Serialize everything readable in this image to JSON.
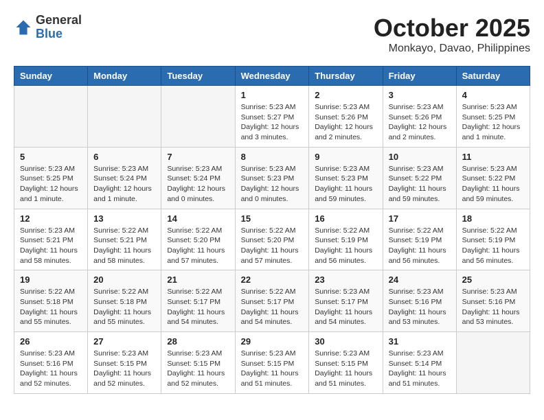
{
  "header": {
    "logo_general": "General",
    "logo_blue": "Blue",
    "title": "October 2025",
    "location": "Monkayo, Davao, Philippines"
  },
  "weekdays": [
    "Sunday",
    "Monday",
    "Tuesday",
    "Wednesday",
    "Thursday",
    "Friday",
    "Saturday"
  ],
  "weeks": [
    [
      {
        "day": "",
        "info": ""
      },
      {
        "day": "",
        "info": ""
      },
      {
        "day": "",
        "info": ""
      },
      {
        "day": "1",
        "info": "Sunrise: 5:23 AM\nSunset: 5:27 PM\nDaylight: 12 hours\nand 3 minutes."
      },
      {
        "day": "2",
        "info": "Sunrise: 5:23 AM\nSunset: 5:26 PM\nDaylight: 12 hours\nand 2 minutes."
      },
      {
        "day": "3",
        "info": "Sunrise: 5:23 AM\nSunset: 5:26 PM\nDaylight: 12 hours\nand 2 minutes."
      },
      {
        "day": "4",
        "info": "Sunrise: 5:23 AM\nSunset: 5:25 PM\nDaylight: 12 hours\nand 1 minute."
      }
    ],
    [
      {
        "day": "5",
        "info": "Sunrise: 5:23 AM\nSunset: 5:25 PM\nDaylight: 12 hours\nand 1 minute."
      },
      {
        "day": "6",
        "info": "Sunrise: 5:23 AM\nSunset: 5:24 PM\nDaylight: 12 hours\nand 1 minute."
      },
      {
        "day": "7",
        "info": "Sunrise: 5:23 AM\nSunset: 5:24 PM\nDaylight: 12 hours\nand 0 minutes."
      },
      {
        "day": "8",
        "info": "Sunrise: 5:23 AM\nSunset: 5:23 PM\nDaylight: 12 hours\nand 0 minutes."
      },
      {
        "day": "9",
        "info": "Sunrise: 5:23 AM\nSunset: 5:23 PM\nDaylight: 11 hours\nand 59 minutes."
      },
      {
        "day": "10",
        "info": "Sunrise: 5:23 AM\nSunset: 5:22 PM\nDaylight: 11 hours\nand 59 minutes."
      },
      {
        "day": "11",
        "info": "Sunrise: 5:23 AM\nSunset: 5:22 PM\nDaylight: 11 hours\nand 59 minutes."
      }
    ],
    [
      {
        "day": "12",
        "info": "Sunrise: 5:23 AM\nSunset: 5:21 PM\nDaylight: 11 hours\nand 58 minutes."
      },
      {
        "day": "13",
        "info": "Sunrise: 5:22 AM\nSunset: 5:21 PM\nDaylight: 11 hours\nand 58 minutes."
      },
      {
        "day": "14",
        "info": "Sunrise: 5:22 AM\nSunset: 5:20 PM\nDaylight: 11 hours\nand 57 minutes."
      },
      {
        "day": "15",
        "info": "Sunrise: 5:22 AM\nSunset: 5:20 PM\nDaylight: 11 hours\nand 57 minutes."
      },
      {
        "day": "16",
        "info": "Sunrise: 5:22 AM\nSunset: 5:19 PM\nDaylight: 11 hours\nand 56 minutes."
      },
      {
        "day": "17",
        "info": "Sunrise: 5:22 AM\nSunset: 5:19 PM\nDaylight: 11 hours\nand 56 minutes."
      },
      {
        "day": "18",
        "info": "Sunrise: 5:22 AM\nSunset: 5:19 PM\nDaylight: 11 hours\nand 56 minutes."
      }
    ],
    [
      {
        "day": "19",
        "info": "Sunrise: 5:22 AM\nSunset: 5:18 PM\nDaylight: 11 hours\nand 55 minutes."
      },
      {
        "day": "20",
        "info": "Sunrise: 5:22 AM\nSunset: 5:18 PM\nDaylight: 11 hours\nand 55 minutes."
      },
      {
        "day": "21",
        "info": "Sunrise: 5:22 AM\nSunset: 5:17 PM\nDaylight: 11 hours\nand 54 minutes."
      },
      {
        "day": "22",
        "info": "Sunrise: 5:22 AM\nSunset: 5:17 PM\nDaylight: 11 hours\nand 54 minutes."
      },
      {
        "day": "23",
        "info": "Sunrise: 5:23 AM\nSunset: 5:17 PM\nDaylight: 11 hours\nand 54 minutes."
      },
      {
        "day": "24",
        "info": "Sunrise: 5:23 AM\nSunset: 5:16 PM\nDaylight: 11 hours\nand 53 minutes."
      },
      {
        "day": "25",
        "info": "Sunrise: 5:23 AM\nSunset: 5:16 PM\nDaylight: 11 hours\nand 53 minutes."
      }
    ],
    [
      {
        "day": "26",
        "info": "Sunrise: 5:23 AM\nSunset: 5:16 PM\nDaylight: 11 hours\nand 52 minutes."
      },
      {
        "day": "27",
        "info": "Sunrise: 5:23 AM\nSunset: 5:15 PM\nDaylight: 11 hours\nand 52 minutes."
      },
      {
        "day": "28",
        "info": "Sunrise: 5:23 AM\nSunset: 5:15 PM\nDaylight: 11 hours\nand 52 minutes."
      },
      {
        "day": "29",
        "info": "Sunrise: 5:23 AM\nSunset: 5:15 PM\nDaylight: 11 hours\nand 51 minutes."
      },
      {
        "day": "30",
        "info": "Sunrise: 5:23 AM\nSunset: 5:15 PM\nDaylight: 11 hours\nand 51 minutes."
      },
      {
        "day": "31",
        "info": "Sunrise: 5:23 AM\nSunset: 5:14 PM\nDaylight: 11 hours\nand 51 minutes."
      },
      {
        "day": "",
        "info": ""
      }
    ]
  ]
}
